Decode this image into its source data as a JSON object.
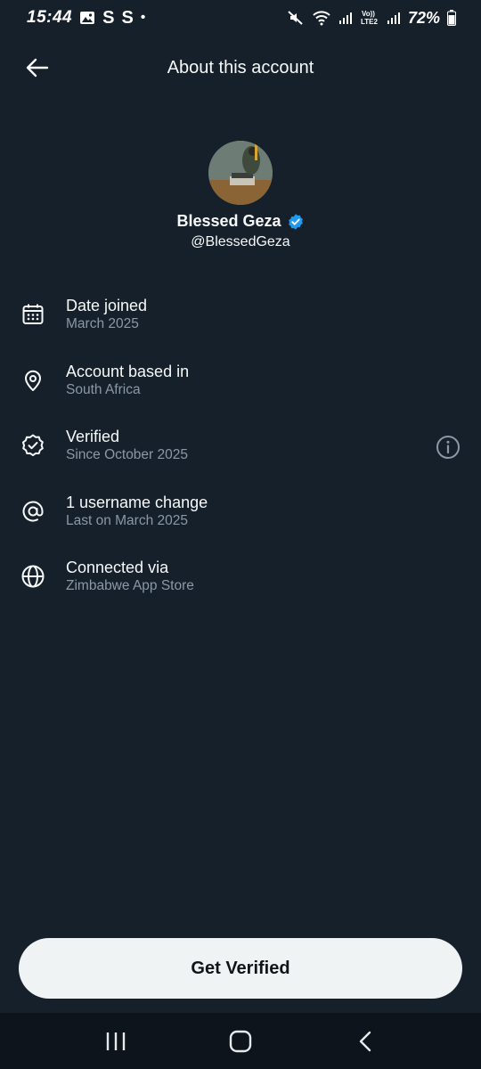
{
  "status_bar": {
    "time": "15:44",
    "left_letters": [
      "S",
      "S"
    ],
    "dot": "•",
    "battery_percent": "72%",
    "icons": [
      "gallery-icon",
      "mute-icon",
      "wifi-icon",
      "signal-icon",
      "volte-icon",
      "signal-icon",
      "battery-icon"
    ]
  },
  "header": {
    "title": "About this account",
    "back_icon": "arrow-left-icon"
  },
  "profile": {
    "display_name": "Blessed Geza",
    "handle": "@BlessedGeza",
    "verified_badge_color": "#1d9bf0"
  },
  "info_items": [
    {
      "icon": "calendar-icon",
      "title": "Date joined",
      "subtitle": "March 2025"
    },
    {
      "icon": "location-pin-icon",
      "title": "Account based in",
      "subtitle": "South Africa"
    },
    {
      "icon": "verified-badge-icon",
      "title": "Verified",
      "subtitle": "Since October 2025",
      "has_info_button": true
    },
    {
      "icon": "at-sign-icon",
      "title": "1 username change",
      "subtitle": "Last on March 2025"
    },
    {
      "icon": "globe-icon",
      "title": "Connected via",
      "subtitle": "Zimbabwe App Store"
    }
  ],
  "cta": {
    "label": "Get Verified"
  },
  "nav_bar": {
    "buttons": [
      "recents-icon",
      "home-icon",
      "back-icon"
    ]
  },
  "colors": {
    "background": "#15202b",
    "text_primary": "#f7f9f9",
    "text_secondary": "#8b98a5",
    "button_bg": "#eff3f4",
    "accent": "#1d9bf0"
  }
}
